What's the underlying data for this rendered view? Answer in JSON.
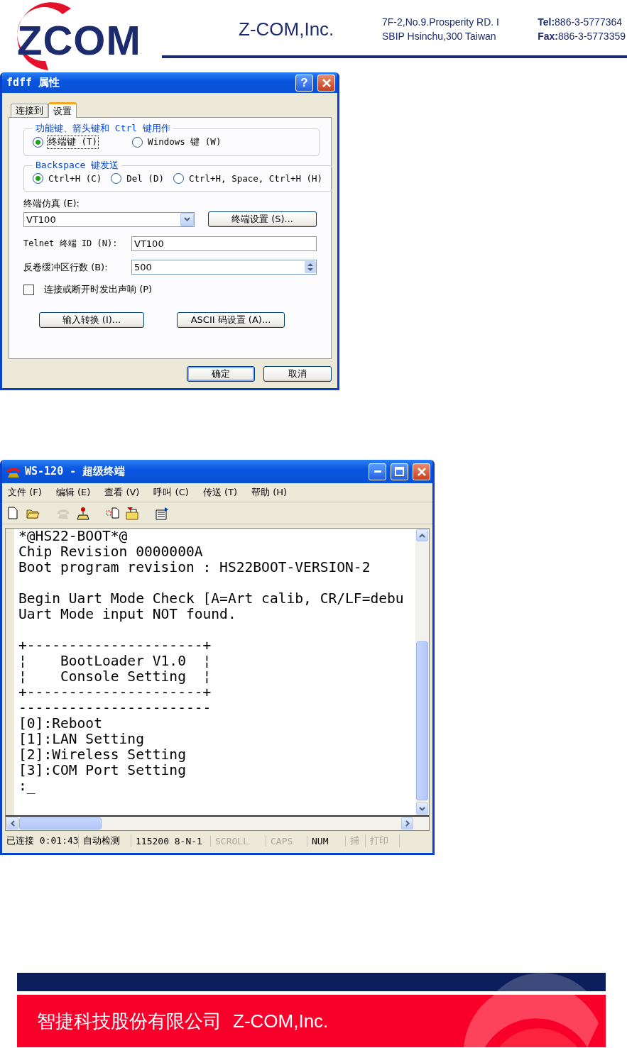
{
  "header": {
    "logo_text": "ZCOM",
    "company": "Z-COM,Inc.",
    "address": [
      "7F-2,No.9.Prosperity RD. I",
      "SBIP Hsinchu,300 Taiwan"
    ],
    "contacts": [
      "**Tel:**886-3-5777364",
      "**Fax:**886-3-5773359"
    ]
  },
  "dialog": {
    "title": "fdff 属性",
    "help": "?",
    "tabs": [
      {
        "label": "连接到",
        "selected": false
      },
      {
        "label": "设置",
        "selected": true
      }
    ],
    "groups": [
      {
        "legend": "功能键、箭头键和 Ctrl 键用作",
        "options": [
          {
            "label": "终端键 (T)",
            "selected": true,
            "focused": true
          },
          {
            "label": "Windows 键 (W)",
            "selected": false,
            "focused": false
          }
        ]
      },
      {
        "legend": "Backspace 键发送",
        "options": [
          {
            "label": "Ctrl+H (C)",
            "selected": true,
            "focused": false
          },
          {
            "label": "Del (D)",
            "selected": false,
            "focused": false
          },
          {
            "label": "Ctrl+H, Space, Ctrl+H (H)",
            "selected": false,
            "focused": false
          }
        ]
      }
    ],
    "emulation": {
      "label": "终端仿真 (E):",
      "value": "VT100",
      "button": "终端设置 (S)..."
    },
    "telnet": {
      "label": "Telnet 终端 ID (N):",
      "value": "VT100"
    },
    "scrollback": {
      "label": "反卷缓冲区行数 (B):",
      "value": "500"
    },
    "beep": {
      "label": "连接或断开时发出声响 (P)",
      "checked": false
    },
    "buttons": [
      "输入转换 (I)...",
      "ASCII 码设置 (A)..."
    ],
    "footer_buttons": [
      {
        "label": "确定",
        "default": true
      },
      {
        "label": "取消",
        "default": false
      }
    ]
  },
  "terminal": {
    "title": "WS-120 - 超级终端",
    "menu": [
      "文件 (F)",
      "编辑 (E)",
      "查看 (V)",
      "呼叫 (C)",
      "传送 (T)",
      "帮助 (H)"
    ],
    "toolbar": [
      [
        {
          "kind": "new",
          "disabled": false
        },
        {
          "kind": "open",
          "disabled": false
        }
      ],
      [
        {
          "kind": "disconnect",
          "disabled": true
        },
        {
          "kind": "dial",
          "disabled": false
        }
      ],
      [
        {
          "kind": "send",
          "disabled": false
        },
        {
          "kind": "receive",
          "disabled": false
        }
      ],
      [
        {
          "kind": "properties",
          "disabled": false
        }
      ]
    ],
    "blocks": [
      [
        "*@HS22-BOOT*@",
        "Chip Revision 0000000A",
        "Boot program revision : HS22BOOT-VERSION-2"
      ],
      [
        "Begin Uart Mode Check [A=Art calib, CR/LF=debu",
        "Uart Mode input NOT found."
      ],
      [
        "+---------------------+",
        "¦    BootLoader V1.0  ¦",
        "¦    Console Setting  ¦",
        "+---------------------+",
        "-----------------------",
        "[0]:Reboot",
        "[1]:LAN Setting",
        "[2]:Wireless Setting",
        "[3]:COM Port Setting",
        ":_"
      ]
    ],
    "status": [
      {
        "text": "已连接 0:01:43",
        "disabled": false
      },
      {
        "text": "自动检测",
        "disabled": false
      },
      {
        "text": "115200 8-N-1",
        "disabled": false
      },
      {
        "text": "SCROLL",
        "disabled": true
      },
      {
        "text": "CAPS",
        "disabled": true
      },
      {
        "text": "NUM",
        "disabled": false
      },
      {
        "text": "捕",
        "disabled": true
      },
      {
        "text": "打印",
        "disabled": true
      }
    ]
  },
  "footer": {
    "company_cn": "智捷科技股份有限公司",
    "company_en": "Z-COM,Inc."
  }
}
